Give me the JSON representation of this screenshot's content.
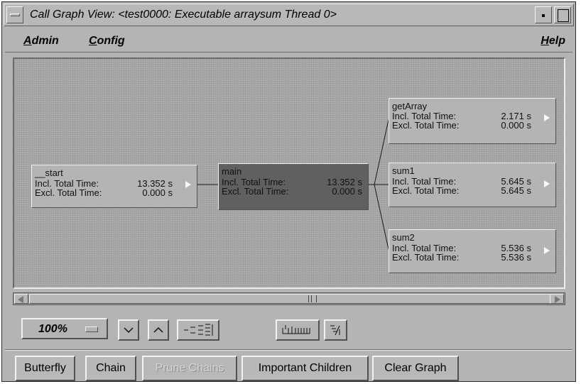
{
  "window": {
    "title": "Call Graph View: <test0000: Executable arraysum Thread 0>"
  },
  "menubar": {
    "admin": {
      "first": "A",
      "rest": "dmin"
    },
    "config": {
      "first": "C",
      "rest": "onfig"
    },
    "help": {
      "first": "H",
      "rest": "elp"
    }
  },
  "graph": {
    "nodes": [
      {
        "id": "start",
        "name": "__start",
        "incl_label": "Incl. Total Time:",
        "incl": "13.352 s",
        "excl_label": "Excl. Total Time:",
        "excl": "0.000 s"
      },
      {
        "id": "main",
        "name": "main",
        "incl_label": "Incl. Total Time:",
        "incl": "13.352 s",
        "excl_label": "Excl. Total Time:",
        "excl": "0.000 s"
      },
      {
        "id": "getarray",
        "name": "getArray",
        "incl_label": "Incl. Total Time:",
        "incl": "2.171 s",
        "excl_label": "Excl. Total Time:",
        "excl": "0.000 s"
      },
      {
        "id": "sum1",
        "name": "sum1",
        "incl_label": "Incl. Total Time:",
        "incl": "5.645 s",
        "excl_label": "Excl. Total Time:",
        "excl": "5.645 s"
      },
      {
        "id": "sum2",
        "name": "sum2",
        "incl_label": "Incl. Total Time:",
        "incl": "5.536 s",
        "excl_label": "Excl. Total Time:",
        "excl": "5.536 s"
      }
    ],
    "selected": "main"
  },
  "toolbar": {
    "zoom": "100%"
  },
  "actions": {
    "butterfly": "Butterfly",
    "chain": "Chain",
    "prune_chains": "Prune Chains",
    "important_children": "Important Children",
    "clear_graph": "Clear Graph"
  },
  "colors": {
    "window_bg": "#b4b4b4",
    "canvas_bg": "#a8a8a8",
    "selected_node": "#606060"
  }
}
